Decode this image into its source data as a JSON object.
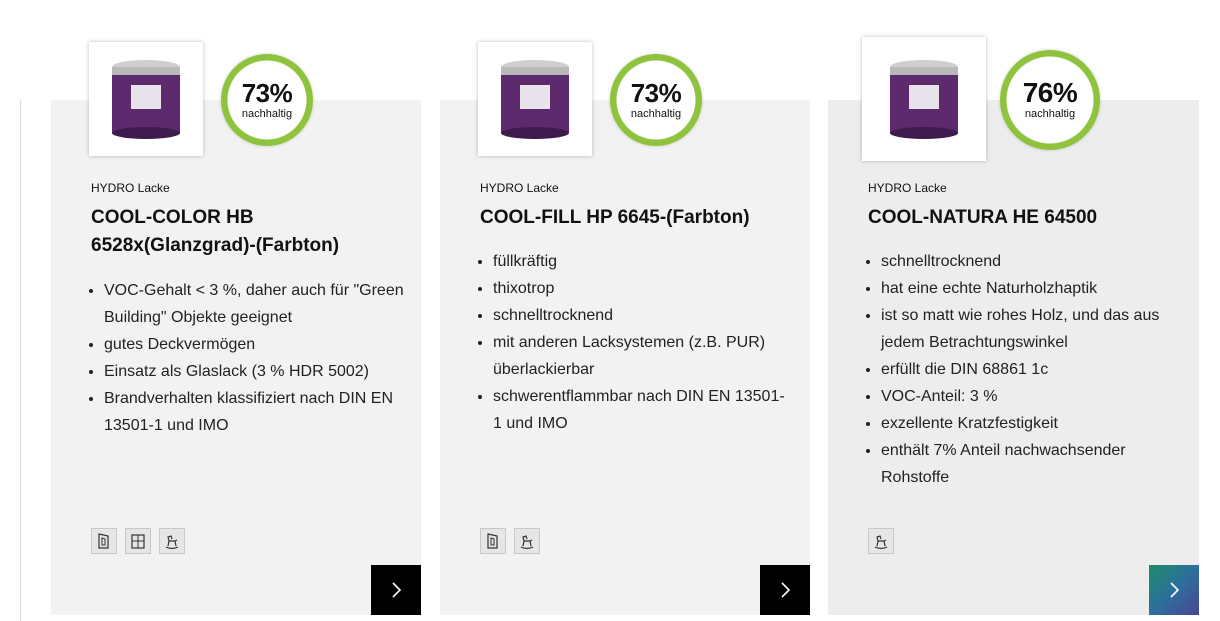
{
  "products": [
    {
      "percent": "73%",
      "percent_label": "nachhaltig",
      "brand": "HYDRO Lacke",
      "title": "COOL-COLOR HB 6528x(Glanzgrad)-(Farbton)",
      "features": [
        "VOC-Gehalt < 3 %, daher auch für \"Green Building\" Objekte geeignet",
        "gutes Deckvermögen",
        "Einsatz als Glaslack (3 % HDR 5002)",
        "Brandverhalten klassifiziert nach DIN EN 13501-1 und IMO"
      ],
      "icons": [
        "door-icon",
        "cabinet-icon",
        "rocking-horse-icon"
      ]
    },
    {
      "percent": "73%",
      "percent_label": "nachhaltig",
      "brand": "HYDRO Lacke",
      "title": "COOL-FILL HP 6645-(Farbton)",
      "features": [
        "füllkräftig",
        "thixotrop",
        "schnelltrocknend",
        "mit anderen Lacksystemen (z.B. PUR) überlackierbar",
        "schwerentflammbar nach DIN EN 13501-1 und IMO"
      ],
      "icons": [
        "door-icon",
        "rocking-horse-icon"
      ]
    },
    {
      "percent": "76%",
      "percent_label": "nachhaltig",
      "brand": "HYDRO Lacke",
      "title": "COOL-NATURA HE 64500",
      "features": [
        "schnelltrocknend",
        "hat eine echte Naturholzhaptik",
        "ist so matt wie rohes Holz, und das aus jedem Betrachtungswinkel",
        "erfüllt die DIN 68861 1c",
        "VOC-Anteil: 3 %",
        "exzellente Kratzfestigkeit",
        "enthält 7% Anteil nachwachsender Rohstoffe"
      ],
      "icons": [
        "rocking-horse-icon"
      ]
    }
  ],
  "colors": {
    "badge_ring": "#8fc33d",
    "card_bg": "#f2f2f2",
    "arrow_dark": "#000000"
  }
}
